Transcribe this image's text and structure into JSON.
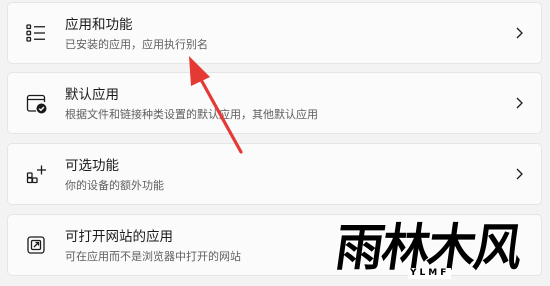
{
  "settings_items": [
    {
      "title": "应用和功能",
      "subtitle": "已安装的应用，应用执行别名",
      "icon": "apps-list-icon"
    },
    {
      "title": "默认应用",
      "subtitle": "根据文件和链接种类设置的默认应用，其他默认应用",
      "icon": "default-apps-icon"
    },
    {
      "title": "可选功能",
      "subtitle": "你的设备的额外功能",
      "icon": "optional-features-icon"
    },
    {
      "title": "可打开网站的应用",
      "subtitle": "可在应用而不是浏览器中打开的网站",
      "icon": "apps-for-websites-icon"
    }
  ],
  "annotation": {
    "arrow_color": "#e53935"
  },
  "watermark": {
    "text": "雨林木风",
    "sub": "YLMF"
  }
}
